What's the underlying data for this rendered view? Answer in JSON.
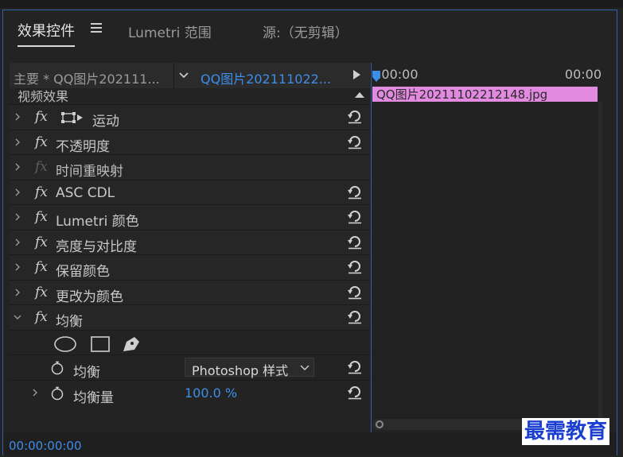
{
  "tabs": {
    "active": "效果控件",
    "lumetri": "Lumetri 范围",
    "source": "源:（无剪辑）"
  },
  "clip_header": {
    "master_label": "主要 * QQ图片202111...",
    "selected_clip": "QQ图片202111022..."
  },
  "timeline": {
    "start_tc": ":00:00",
    "end_tc": "00:00",
    "clip_name": "QQ图片20211102212148.jpg",
    "clip_color": "#e28ae0"
  },
  "effects": {
    "section_label": "视频效果",
    "rows": [
      {
        "name": "运动",
        "reset": true
      },
      {
        "name": "不透明度",
        "reset": true
      },
      {
        "name": "时间重映射",
        "reset": false
      },
      {
        "name": "ASC CDL",
        "reset": true
      },
      {
        "name": "Lumetri 颜色",
        "reset": true
      },
      {
        "name": "亮度与对比度",
        "reset": true
      },
      {
        "name": "保留颜色",
        "reset": true
      },
      {
        "name": "更改为颜色",
        "reset": true
      },
      {
        "name": "均衡",
        "reset": true
      }
    ],
    "equalize": {
      "prop1_label": "均衡",
      "prop1_value": "Photoshop 样式",
      "prop2_label": "均衡量",
      "prop2_value": "100.0 %"
    }
  },
  "footer": {
    "timecode": "00:00:00:00"
  },
  "watermark": "最需教育",
  "colors": {
    "accent_blue": "#3d8ee8",
    "panel_border": "#2f63b0"
  }
}
